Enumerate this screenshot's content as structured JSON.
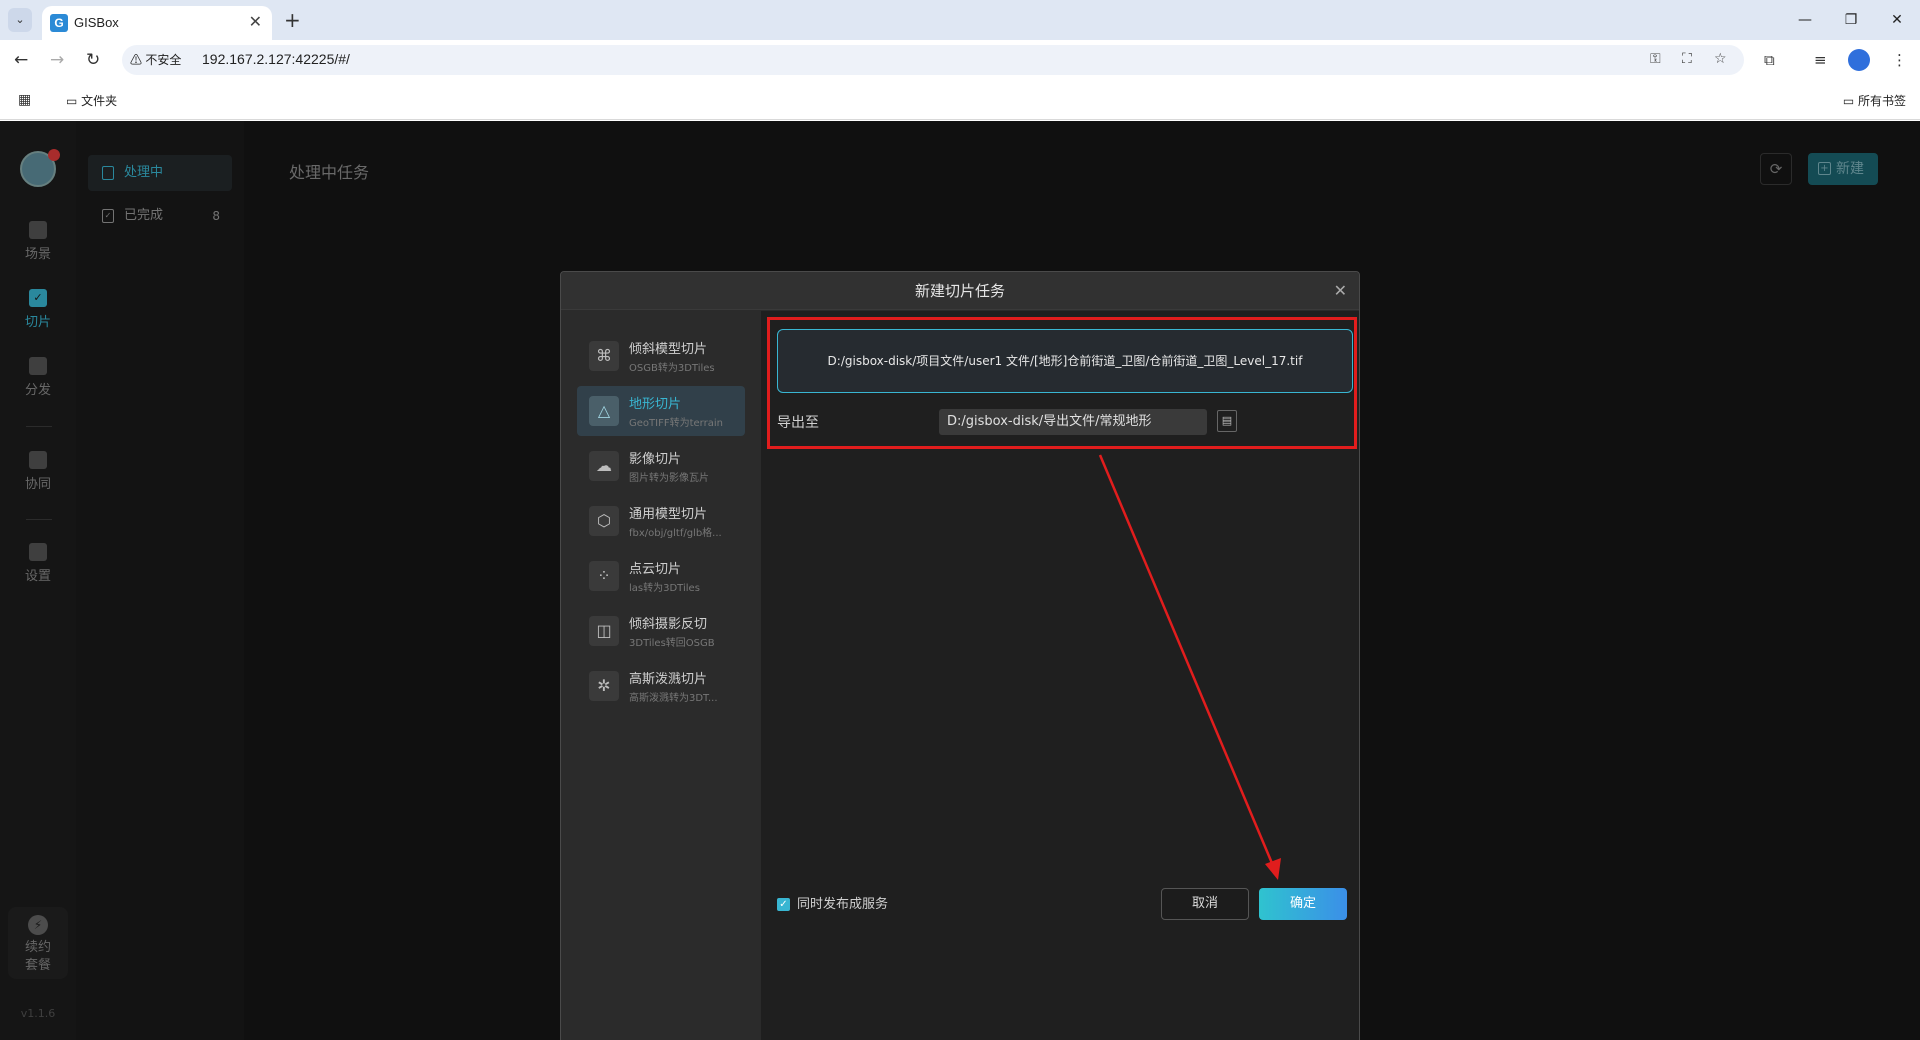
{
  "browser": {
    "tab_title": "GISBox",
    "tab_favicon": "G",
    "insecure_label": "不安全",
    "url": "192.167.2.127:42225/#/",
    "bookmark_folder": "文件夹",
    "bookmarks_all": "所有书签"
  },
  "rail": {
    "items": [
      {
        "label": "场景",
        "icon": "scene-icon"
      },
      {
        "label": "切片",
        "icon": "slice-icon",
        "active": true
      },
      {
        "label": "分发",
        "icon": "distribute-icon"
      },
      {
        "label": "协同",
        "icon": "collab-icon"
      },
      {
        "label": "设置",
        "icon": "settings-icon"
      }
    ],
    "renew_label_1": "续约",
    "renew_label_2": "套餐",
    "version": "v1.1.6"
  },
  "subnav": {
    "items": [
      {
        "label": "处理中",
        "active": true
      },
      {
        "label": "已完成",
        "count": "8"
      }
    ]
  },
  "main": {
    "title": "处理中任务",
    "new_label": "新建"
  },
  "dialog": {
    "title": "新建切片任务",
    "types": [
      {
        "name": "倾斜模型切片",
        "desc": "OSGB转为3DTiles",
        "icon": "oblique-model-icon"
      },
      {
        "name": "地形切片",
        "desc": "GeoTIFF转为terrain",
        "icon": "terrain-icon",
        "active": true
      },
      {
        "name": "影像切片",
        "desc": "图片转为影像瓦片",
        "icon": "imagery-icon"
      },
      {
        "name": "通用模型切片",
        "desc": "fbx/obj/gltf/glb格...",
        "icon": "generic-model-icon"
      },
      {
        "name": "点云切片",
        "desc": "las转为3DTiles",
        "icon": "point-cloud-icon"
      },
      {
        "name": "倾斜摄影反切",
        "desc": "3DTiles转回OSGB",
        "icon": "reverse-slice-icon"
      },
      {
        "name": "高斯泼溅切片",
        "desc": "高斯泼溅转为3DT...",
        "icon": "gaussian-splat-icon"
      }
    ],
    "source_path": "D:/gisbox-disk/项目文件/user1 文件/[地形]仓前街道_卫图/仓前街道_卫图_Level_17.tif",
    "export_label": "导出至",
    "export_path": "D:/gisbox-disk/导出文件/常规地形",
    "publish_label": "同时发布成服务",
    "publish_checked": true,
    "cancel_label": "取消",
    "ok_label": "确定"
  },
  "colors": {
    "accent": "#39b6d2",
    "annotation_red": "#e11d1d"
  }
}
